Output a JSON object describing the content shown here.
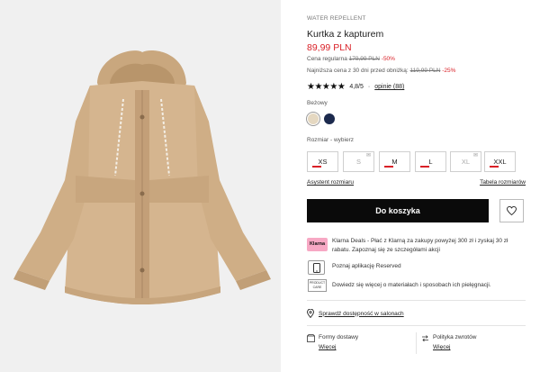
{
  "product": {
    "tag": "WATER REPELLENT",
    "title": "Kurtka z kapturem",
    "price": "89,99 PLN",
    "regular_label": "Cena regularna",
    "regular_price": "179,99 PLN",
    "regular_discount": "-50%",
    "lowest_label": "Najniższa cena z 30 dni przed obniżką:",
    "lowest_price": "119,99 PLN",
    "lowest_discount": "-25%"
  },
  "rating": {
    "stars": "★★★★★",
    "score": "4,8/5",
    "separator": "·",
    "reviews_link": "opinie (88)",
    "value": 4.8
  },
  "color": {
    "label": "Beżowy",
    "swatches": [
      {
        "name": "beige",
        "hex": "#e5d8c1",
        "selected": true
      },
      {
        "name": "navy",
        "hex": "#1c2a4d",
        "selected": false
      }
    ]
  },
  "sizes": {
    "label": "Rozmiar -",
    "prompt": "wybierz",
    "options": [
      "XS",
      "S",
      "M",
      "L",
      "XL",
      "XXL"
    ]
  },
  "links": {
    "size_assistant": "Asystent rozmiaru",
    "size_chart": "Tabela rozmiarów"
  },
  "cart": {
    "button_label": "Do koszyka"
  },
  "klarna": {
    "logo_text": "Klarna",
    "text": "Klarna Deals - Płać z Klarną za zakupy powyżej 300 zł i zyskaj 30 zł rabatu. Zapoznaj się ze szczegółami akcji"
  },
  "app": {
    "text": "Poznaj aplikację Reserved"
  },
  "care": {
    "icon_text_1": "PRODUCT",
    "icon_text_2": "CARE",
    "text": "Dowiedz się więcej o materiałach i sposobach ich pielęgnacji."
  },
  "stock": {
    "text": "Sprawdź dostępność w salonach"
  },
  "delivery": {
    "label": "Formy dostawy",
    "link": "Więcej"
  },
  "returns": {
    "label": "Polityka zwrotów",
    "link": "Więcej"
  },
  "colors": {
    "accent_red": "#d92027",
    "button_black": "#0a0a0a",
    "jacket": "#d5b58f"
  }
}
